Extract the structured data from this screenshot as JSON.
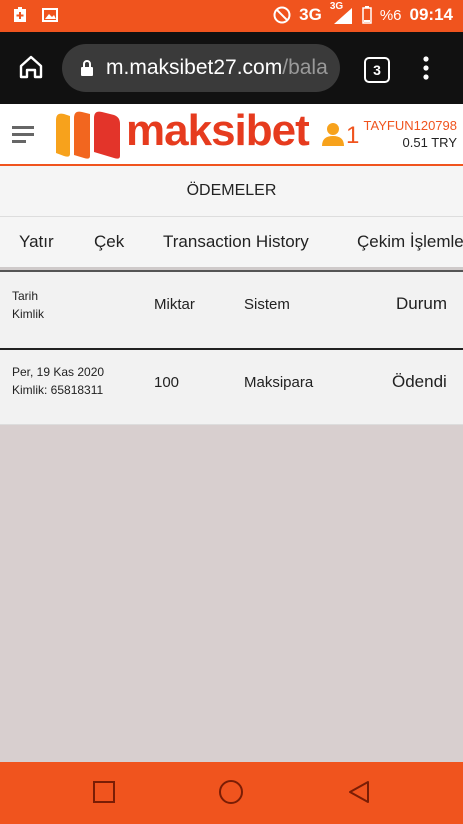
{
  "status_bar": {
    "network": "3G",
    "network_sup": "3G",
    "battery": "%6",
    "time": "09:14"
  },
  "browser": {
    "url_host": "m.maksibet27.com",
    "url_path": "/bala",
    "tab_count": "3"
  },
  "header": {
    "brand": "maksibet",
    "user_count": "1",
    "username": "TAYFUN120798",
    "balance": "0.51 TRY"
  },
  "page": {
    "title": "ÖDEMELER"
  },
  "tabs": [
    {
      "label": "Yatır"
    },
    {
      "label": "Çek"
    },
    {
      "label": "Transaction History"
    },
    {
      "label": "Çekim İşlemleri"
    }
  ],
  "table": {
    "headers": {
      "date": "Tarih",
      "id": "Kimlik",
      "amount": "Miktar",
      "system": "Sistem",
      "status": "Durum"
    },
    "rows": [
      {
        "date": "Per, 19 Kas 2020",
        "id": "Kimlik: 65818311",
        "amount": "100",
        "system": "Maksipara",
        "status": "Ödendi"
      }
    ]
  },
  "colors": {
    "accent": "#f0541e",
    "background": "#d8cfcf"
  }
}
